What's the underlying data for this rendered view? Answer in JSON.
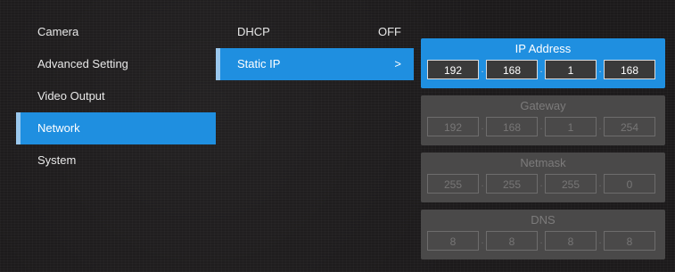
{
  "menu": {
    "items": [
      {
        "label": "Camera"
      },
      {
        "label": "Advanced Setting"
      },
      {
        "label": "Video Output"
      },
      {
        "label": "Network"
      },
      {
        "label": "System"
      }
    ]
  },
  "network": {
    "dhcp_label": "DHCP",
    "dhcp_value": "OFF",
    "static_ip_label": "Static IP",
    "static_ip_arrow": ">"
  },
  "panels": {
    "ip_address": {
      "title": "IP Address",
      "octets": [
        "192",
        "168",
        "1",
        "168"
      ]
    },
    "gateway": {
      "title": "Gateway",
      "octets": [
        "192",
        "168",
        "1",
        "254"
      ]
    },
    "netmask": {
      "title": "Netmask",
      "octets": [
        "255",
        "255",
        "255",
        "0"
      ]
    },
    "dns": {
      "title": "DNS",
      "octets": [
        "8",
        "8",
        "8",
        "8"
      ]
    },
    "separator": "."
  },
  "colors": {
    "accent": "#1f8fe0",
    "panel_inactive": "#4a4949",
    "background": "#1c1a1b"
  }
}
